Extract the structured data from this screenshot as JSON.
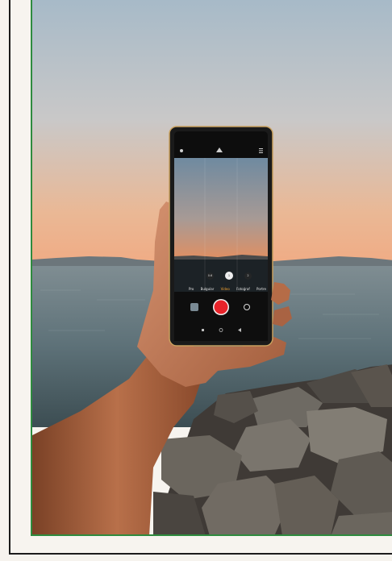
{
  "camera": {
    "zoom_levels": [
      "0.6",
      "1",
      "2"
    ],
    "modes": [
      "Pro",
      "Bulgular",
      "Video",
      "Fotoğraf",
      "Portre"
    ],
    "active_mode": "Video",
    "record_color": "#e8232a"
  },
  "colors": {
    "sky_top": "#a9bcc9",
    "sky_bottom": "#f0b58c",
    "sea": "#5d7279",
    "frame_border": "#2e8b3e",
    "skin": "#c97e58"
  }
}
